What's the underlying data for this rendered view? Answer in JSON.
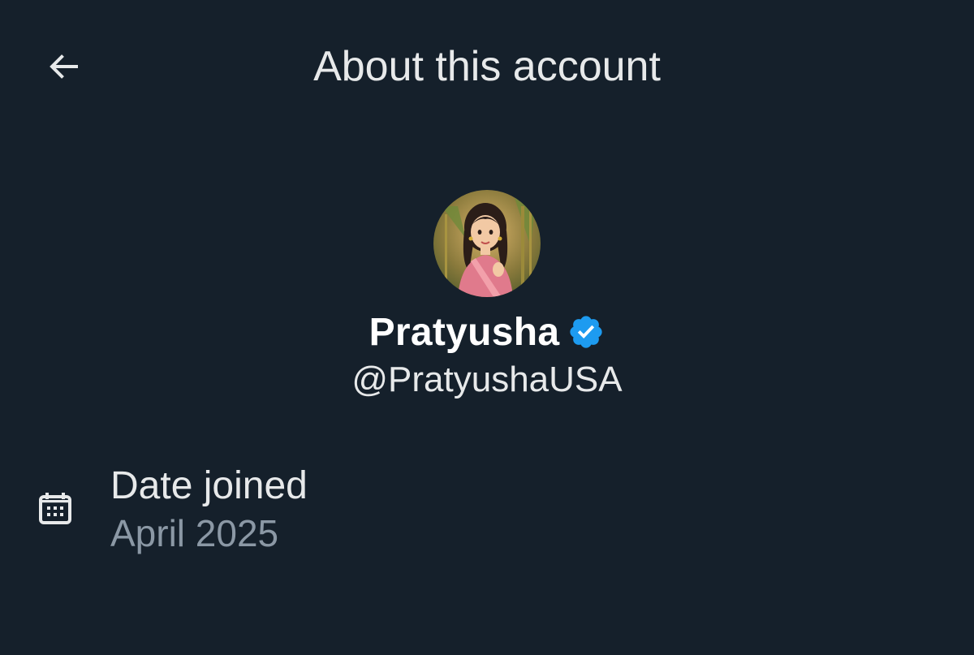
{
  "header": {
    "title": "About this account",
    "back_icon": "arrow-left-icon"
  },
  "profile": {
    "display_name": "Pratyusha",
    "handle": "@PratyushaUSA",
    "verified_icon": "verified-badge-icon",
    "verified_color": "#1d9bf0",
    "avatar_description_icon": "avatar-image"
  },
  "details": {
    "date_joined": {
      "icon": "calendar-icon",
      "label": "Date joined",
      "value": "April 2025"
    }
  },
  "colors": {
    "background": "#15202b",
    "primary_text": "#e7e9ea",
    "secondary_text": "#8b98a5"
  }
}
